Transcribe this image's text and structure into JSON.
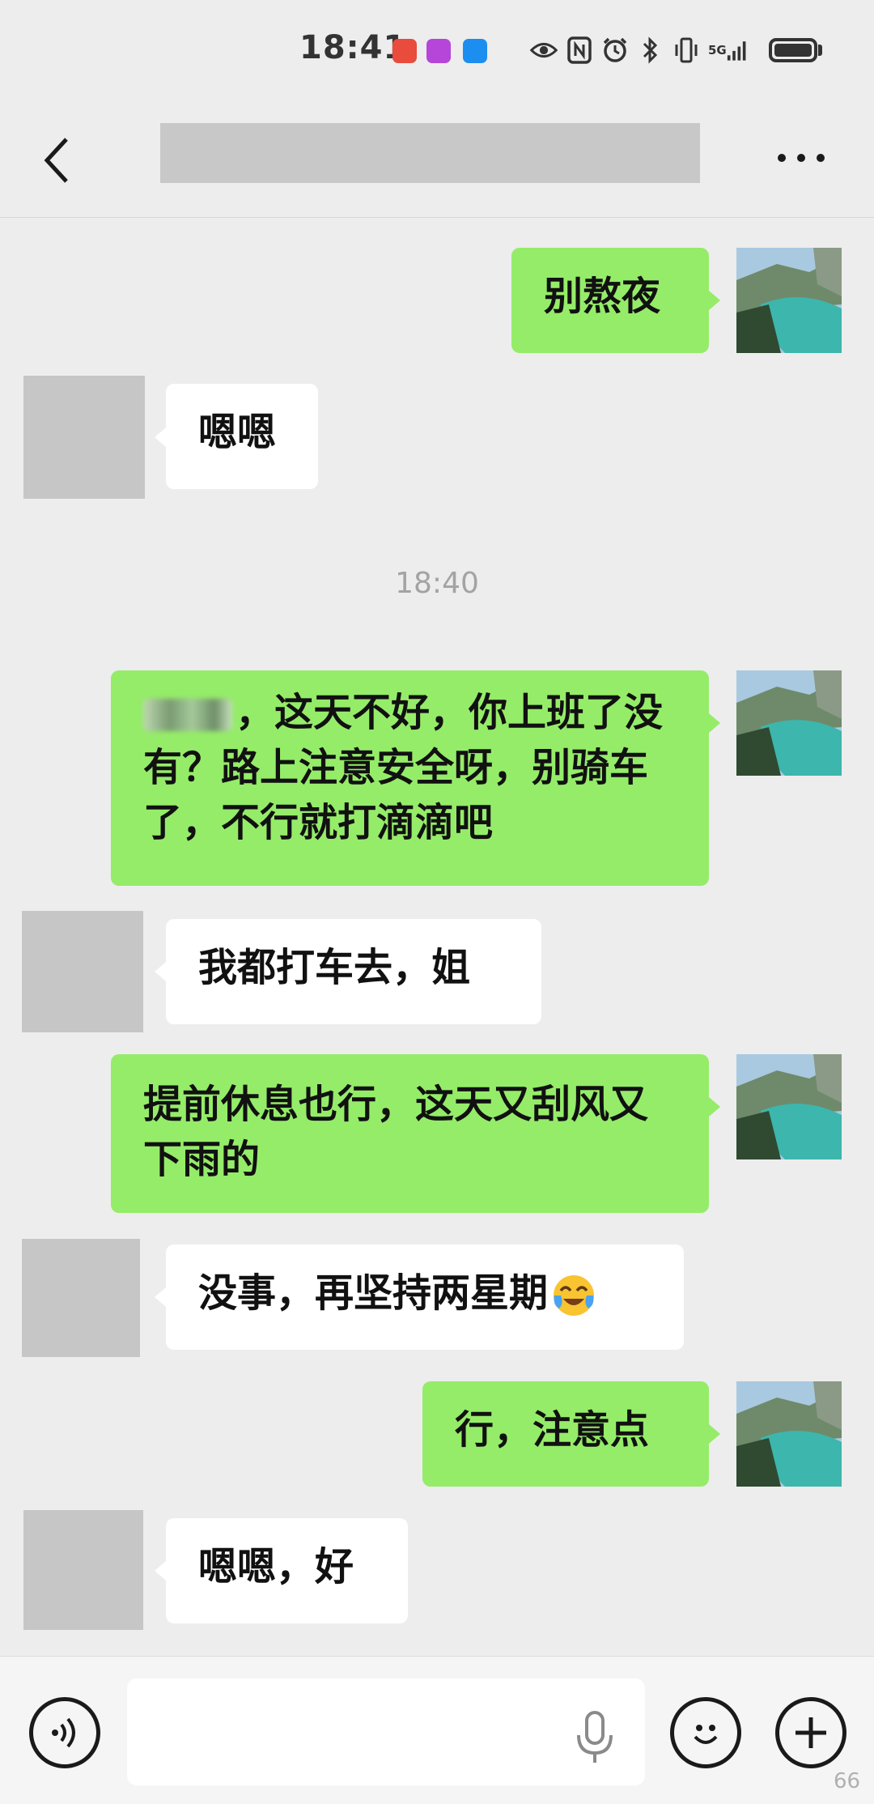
{
  "status_bar": {
    "time": "18:41",
    "signal": "5G",
    "icons": [
      "eye-icon",
      "nfc-icon",
      "alarm-icon",
      "bluetooth-icon",
      "vibrate-icon",
      "signal-icon",
      "battery-icon"
    ],
    "app_icon_colors": [
      "#e94b3c",
      "#b546d9",
      "#1c8ef0"
    ]
  },
  "header": {
    "back_icon": "chevron-left-icon",
    "title": "",
    "more_icon": "more-dots-icon"
  },
  "colors": {
    "outgoing_bubble": "#95ec69",
    "incoming_bubble": "#ffffff",
    "background": "#ededed"
  },
  "messages": [
    {
      "direction": "out",
      "text": "别熬夜"
    },
    {
      "direction": "in",
      "text": "嗯嗯"
    },
    {
      "direction": "timestamp",
      "text": "18:40"
    },
    {
      "direction": "out",
      "text_after_blur": "，这天不好，你上班了没有？路上注意安全呀，别骑车了，不行就打滴滴吧"
    },
    {
      "direction": "in",
      "text": "我都打车去，姐"
    },
    {
      "direction": "out",
      "text": "提前休息也行，这天又刮风又下雨的"
    },
    {
      "direction": "in",
      "text": "没事，再坚持两星期",
      "emoji": "crying-laughing-face"
    },
    {
      "direction": "out",
      "text": "行，注意点"
    },
    {
      "direction": "in",
      "text": "嗯嗯，好"
    }
  ],
  "input_bar": {
    "voice_icon": "voice-icon",
    "mic_icon": "microphone-icon",
    "emoji_icon": "smiley-icon",
    "plus_icon": "plus-icon"
  },
  "corner_number": "66"
}
